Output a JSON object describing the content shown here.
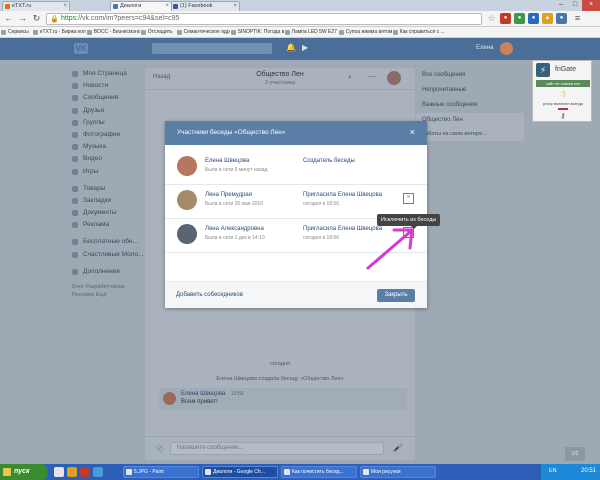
{
  "browser": {
    "tabs": [
      {
        "label": "eTXT.ru",
        "color": "#e86a1e"
      },
      {
        "label": "Диалоги",
        "color": "#4a76a8"
      },
      {
        "label": "(1) Facebook",
        "color": "#3b5998"
      }
    ],
    "address": {
      "https": "https://",
      "rest": "vk.com/im?peers=c94&sel=c95"
    },
    "bookmarks": [
      "Сервисы",
      "eTXT.ru - Биржа копи...",
      "BOCC - Бизнесмэнов ...",
      "Отсладить",
      "Семантическое ядро ...",
      "SINOPTIK: Погода в ...",
      "Лампа LED 5W E27 ...",
      "Супоа жжима вятом ...",
      "Как справиться с ..."
    ]
  },
  "vk": {
    "user_name": "Елена",
    "nav": [
      "Моя Страница",
      "Новости",
      "Сообщения",
      "Друзья",
      "Группы",
      "Фотографии",
      "Музыка",
      "Видео",
      "Игры",
      "Товары",
      "Закладки",
      "Документы",
      "Реклама",
      "Бесплатные обн...",
      "Счастливые Моло...",
      "Дополнения"
    ],
    "nav_footer": [
      "Блог  Разработчикам",
      "Реклама  Ещё"
    ],
    "dialog": {
      "back": "Назад",
      "title": "Общество Лен",
      "subtitle": "3 участника",
      "today": "сегодня",
      "system_message": "Елена Швецова создала беседу «Общество Лен»",
      "message": {
        "author": "Елена Швецова",
        "time": "19:56",
        "text": "Всем привет!"
      },
      "composer_placeholder": "Напишите сообщение..."
    },
    "right_menu": [
      "Все сообщения",
      "Непрочитанные",
      "Важные сообщения",
      "Общество Лен",
      "Заботы на свою интере..."
    ],
    "page_indicator": "1/2"
  },
  "frigate": {
    "name": "friGate",
    "strip": "сайт не списке нет",
    "status": ":)",
    "small": "proxy включен всегда",
    "key": "⚷"
  },
  "modal": {
    "title": "Участники беседы «Общество Лен»",
    "members": [
      {
        "name": "Елена Швецова",
        "last_seen": "Была в сети 6 минут назад",
        "invite": "Создатель беседы",
        "when": "",
        "avatar": "#b77660",
        "removable": false
      },
      {
        "name": "Лена Премудрая",
        "last_seen": "Была в сети 26 мая 2016",
        "invite": "Пригласила Елена Швецова",
        "when": "сегодня в 19:56",
        "avatar": "#a58a6a",
        "removable": true
      },
      {
        "name": "Лена Александровна",
        "last_seen": "Была в сети 1 дек в 14:10",
        "invite": "Пригласила Елена Швецова",
        "when": "сегодня в 19:56",
        "avatar": "#5a6572",
        "removable": true
      }
    ],
    "tooltip": "Исключить из беседы",
    "add_members": "Добавить собеседников",
    "close_label": "Закрыть"
  },
  "taskbar": {
    "start": "пуск",
    "tasks": [
      {
        "label": "5.JPG - Paint",
        "active": false
      },
      {
        "label": "Диалоги - Google Ch...",
        "active": true
      },
      {
        "label": "Как почистить бесед...",
        "active": false
      },
      {
        "label": "Мои рисунки",
        "active": false
      }
    ],
    "lang": "EN",
    "clock": "20:51"
  },
  "colors": {
    "accent_annotation": "#d33bd3",
    "vk_header": "#4a6e98",
    "modal_header": "#5b7ea6"
  }
}
